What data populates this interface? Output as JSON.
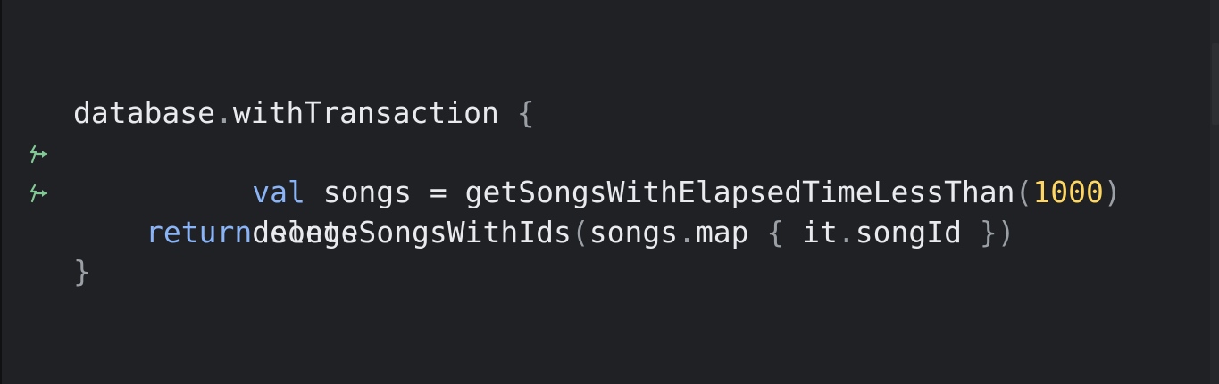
{
  "editor": {
    "colors": {
      "background": "#202124",
      "text": "#e8eaed",
      "keyword": "#8ab4f8",
      "number": "#fdd663",
      "punctuation": "#9aa0a6",
      "gutter_icon": "#81c995"
    },
    "gutter_icon_name": "suspend-call-icon",
    "lines": {
      "l1": {
        "receiver": "database",
        "dot": ".",
        "method": "withTransaction ",
        "brace_open": "{"
      },
      "l2": {
        "keyword": "val",
        "assign": " songs = getSongsWithElapsedTimeLessThan",
        "paren_open": "(",
        "number": "1000",
        "paren_close": ")"
      },
      "l3": {
        "call": "deleteSongsWithIds",
        "paren_open": "(",
        "receiver": "songs",
        "dot": ".",
        "method": "map ",
        "brace_open": "{",
        "lambda_body_a": " it",
        "dot2": ".",
        "lambda_body_b": "songId ",
        "brace_close": "}",
        "paren_close": ")"
      },
      "l4": {
        "keyword": "return",
        "value": " songs"
      },
      "l5": {
        "brace_close": "}"
      }
    }
  }
}
